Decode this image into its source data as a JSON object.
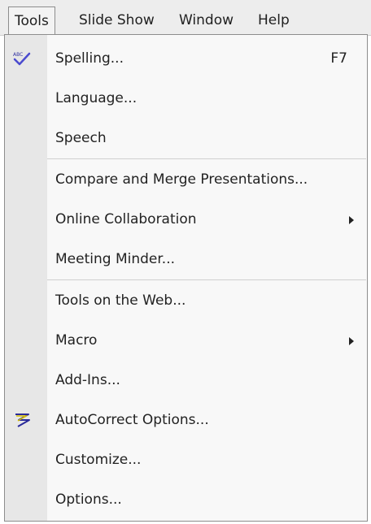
{
  "menubar": {
    "items": [
      {
        "label": "Tools",
        "active": true
      },
      {
        "label": "Slide Show",
        "active": false
      },
      {
        "label": "Window",
        "active": false
      },
      {
        "label": "Help",
        "active": false
      }
    ]
  },
  "menu": {
    "items": [
      {
        "label": "Spelling...",
        "shortcut": "F7",
        "icon": "spelling-check-icon",
        "submenu": false
      },
      {
        "label": "Language...",
        "shortcut": "",
        "icon": "",
        "submenu": false
      },
      {
        "label": "Speech",
        "shortcut": "",
        "icon": "",
        "submenu": false
      },
      {
        "label": "Compare and Merge Presentations...",
        "shortcut": "",
        "icon": "",
        "submenu": false
      },
      {
        "label": "Online Collaboration",
        "shortcut": "",
        "icon": "",
        "submenu": true
      },
      {
        "label": "Meeting Minder...",
        "shortcut": "",
        "icon": "",
        "submenu": false
      },
      {
        "label": "Tools on the Web...",
        "shortcut": "",
        "icon": "",
        "submenu": false
      },
      {
        "label": "Macro",
        "shortcut": "",
        "icon": "",
        "submenu": true
      },
      {
        "label": "Add-Ins...",
        "shortcut": "",
        "icon": "",
        "submenu": false
      },
      {
        "label": "AutoCorrect Options...",
        "shortcut": "",
        "icon": "autocorrect-lightning-icon",
        "submenu": false
      },
      {
        "label": "Customize...",
        "shortcut": "",
        "icon": "",
        "submenu": false
      },
      {
        "label": "Options...",
        "shortcut": "",
        "icon": "",
        "submenu": false
      }
    ]
  }
}
